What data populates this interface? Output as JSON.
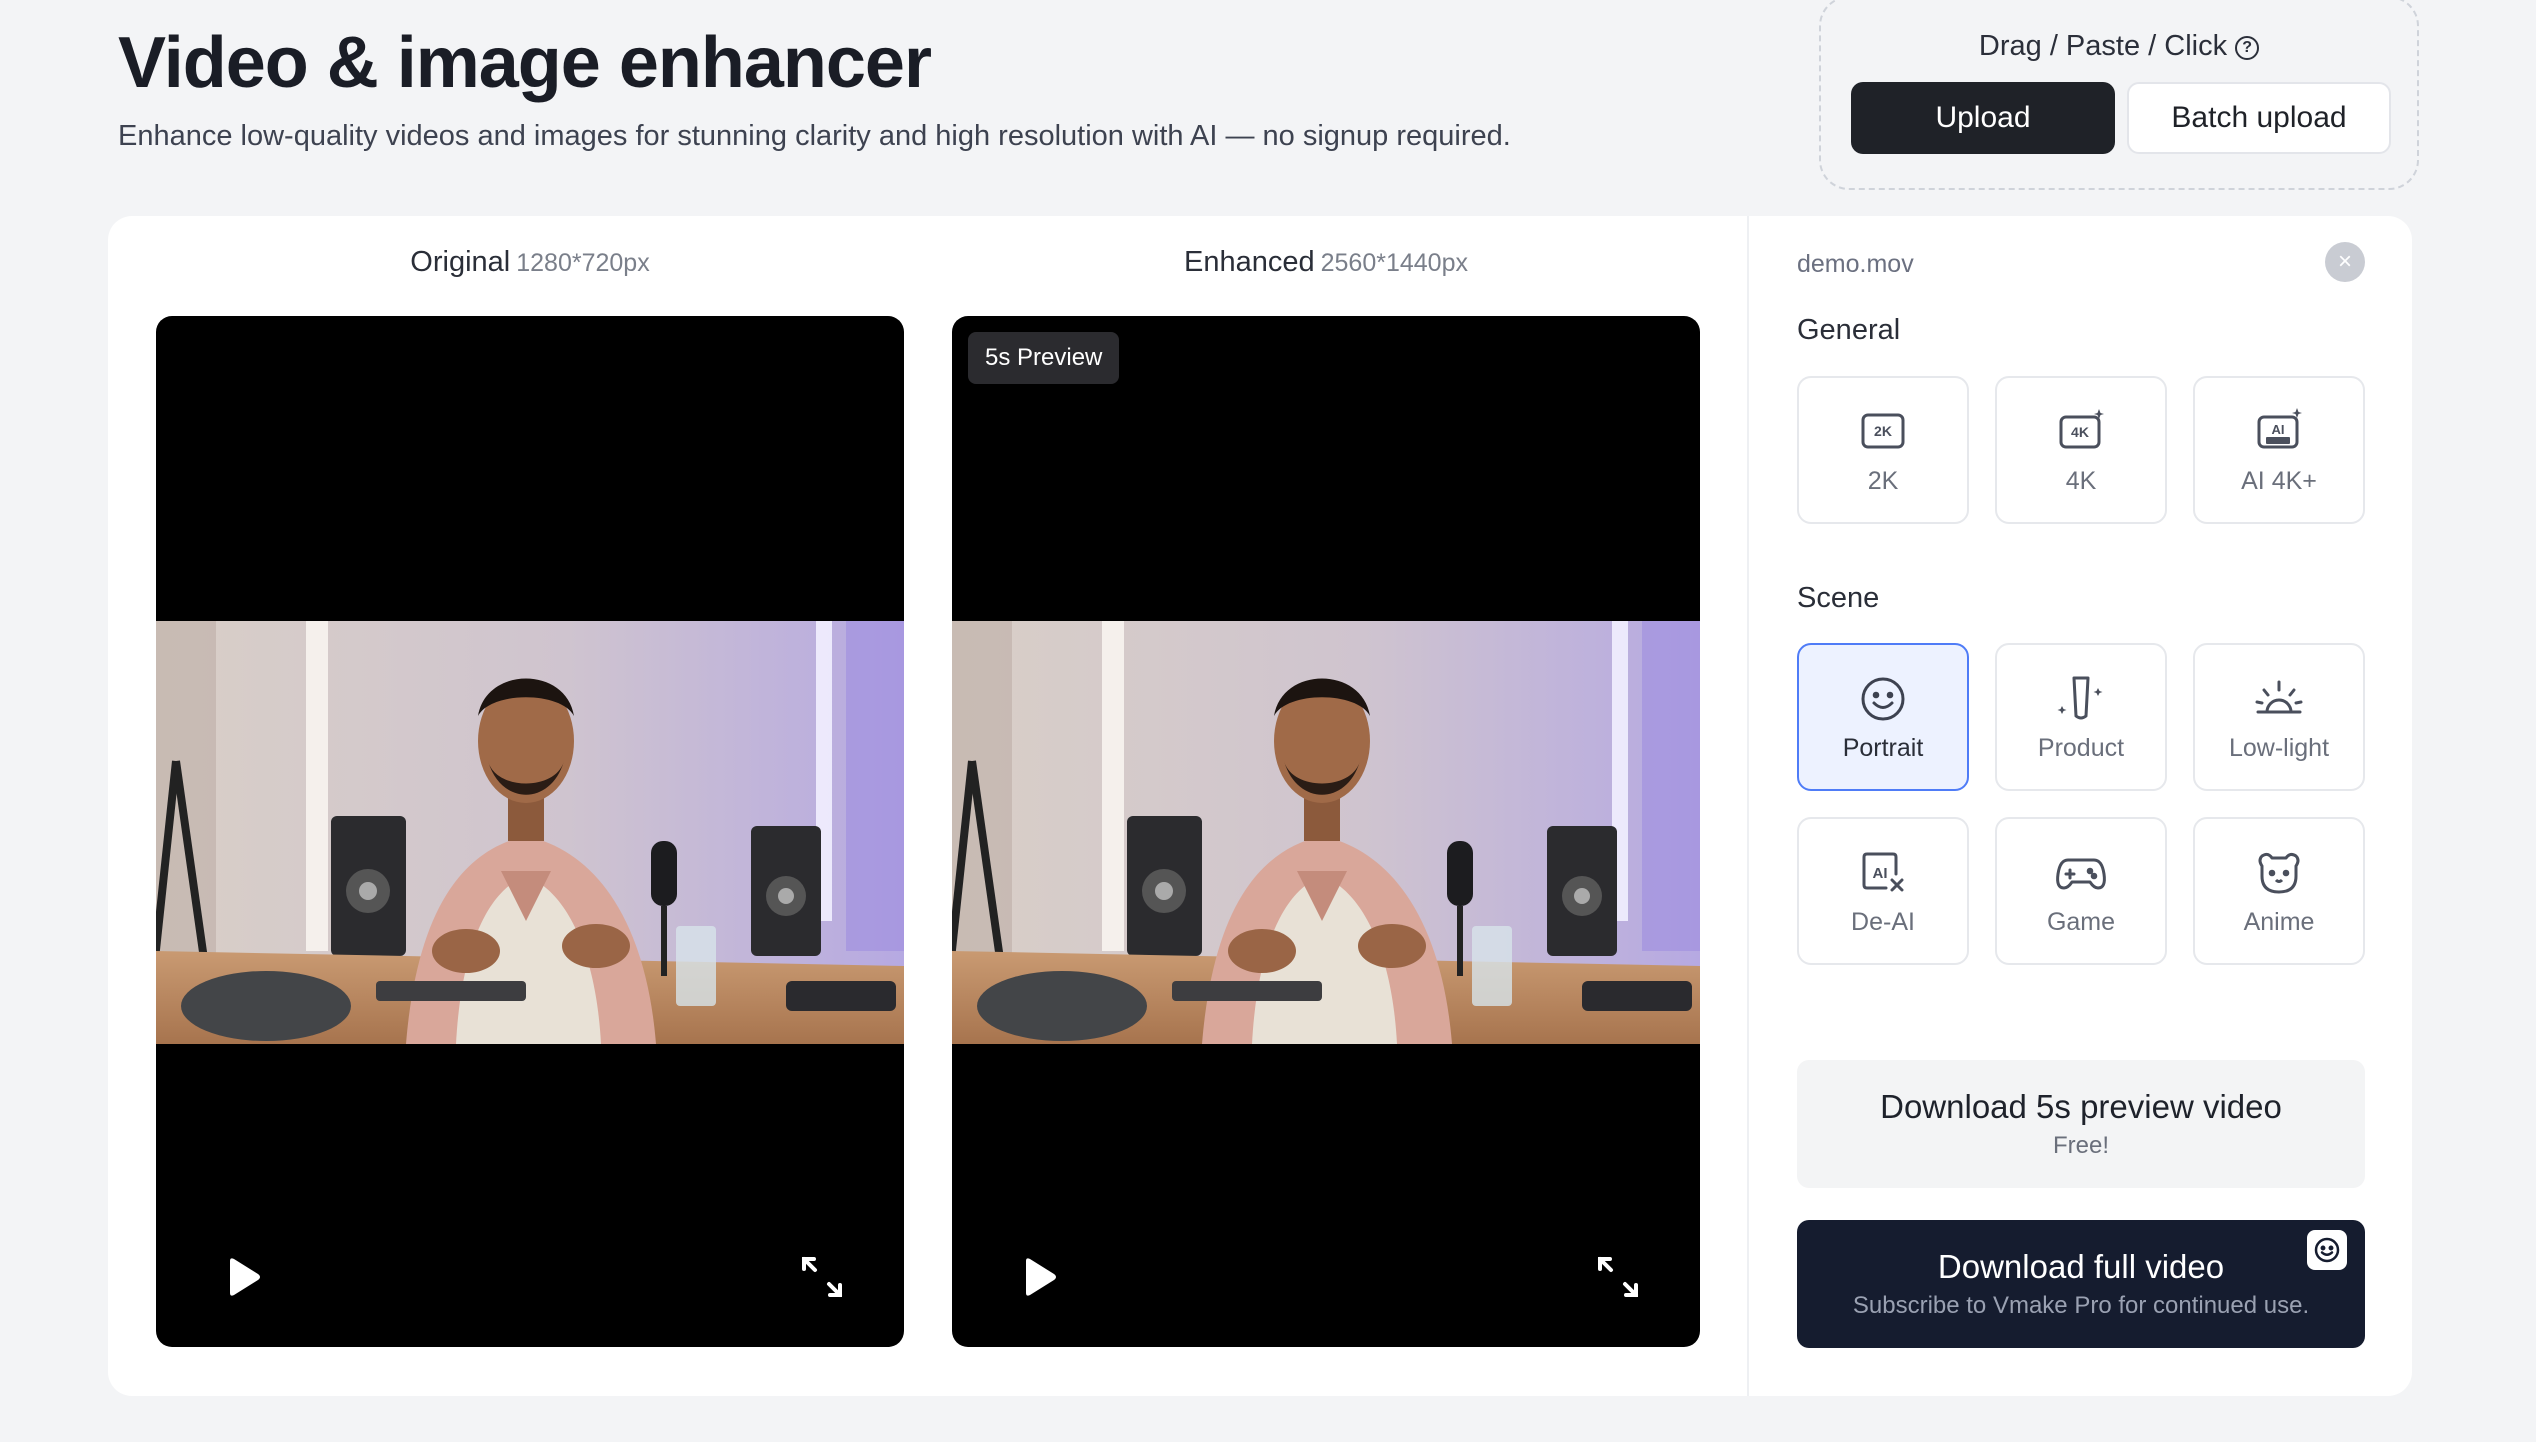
{
  "header": {
    "title": "Video & image enhancer",
    "subtitle": "Enhance low-quality videos and images for stunning clarity and high resolution with AI — no signup required."
  },
  "upload": {
    "hint": "Drag / Paste / Click",
    "upload_label": "Upload",
    "batch_label": "Batch upload"
  },
  "panes": {
    "original": {
      "label": "Original",
      "dims": "1280*720px"
    },
    "enhanced": {
      "label": "Enhanced",
      "dims": "2560*1440px",
      "badge": "5s Preview"
    }
  },
  "sidebar": {
    "filename": "demo.mov",
    "close_glyph": "×",
    "general_label": "General",
    "general_options": [
      {
        "label": "2K",
        "icon": "2k-icon"
      },
      {
        "label": "4K",
        "icon": "4k-icon"
      },
      {
        "label": "AI 4K+",
        "icon": "ai-ultra-icon"
      }
    ],
    "scene_label": "Scene",
    "scene_options": [
      {
        "label": "Portrait",
        "icon": "smiley-face-icon",
        "selected": true
      },
      {
        "label": "Product",
        "icon": "product-bottle-icon",
        "selected": false
      },
      {
        "label": "Low-light",
        "icon": "sunrise-icon",
        "selected": false
      },
      {
        "label": "De-AI",
        "icon": "ai-remove-icon",
        "selected": false
      },
      {
        "label": "Game",
        "icon": "gamepad-icon",
        "selected": false
      },
      {
        "label": "Anime",
        "icon": "bear-icon",
        "selected": false
      }
    ],
    "download_preview": {
      "label": "Download 5s preview video",
      "sub": "Free!"
    },
    "download_full": {
      "label": "Download full video",
      "sub": "Subscribe to Vmake Pro for continued use."
    }
  },
  "colors": {
    "accent": "#4f7cf7",
    "dark_button": "#1f2228",
    "download_full_bg": "#151c2f",
    "page_bg": "#f3f4f6"
  }
}
